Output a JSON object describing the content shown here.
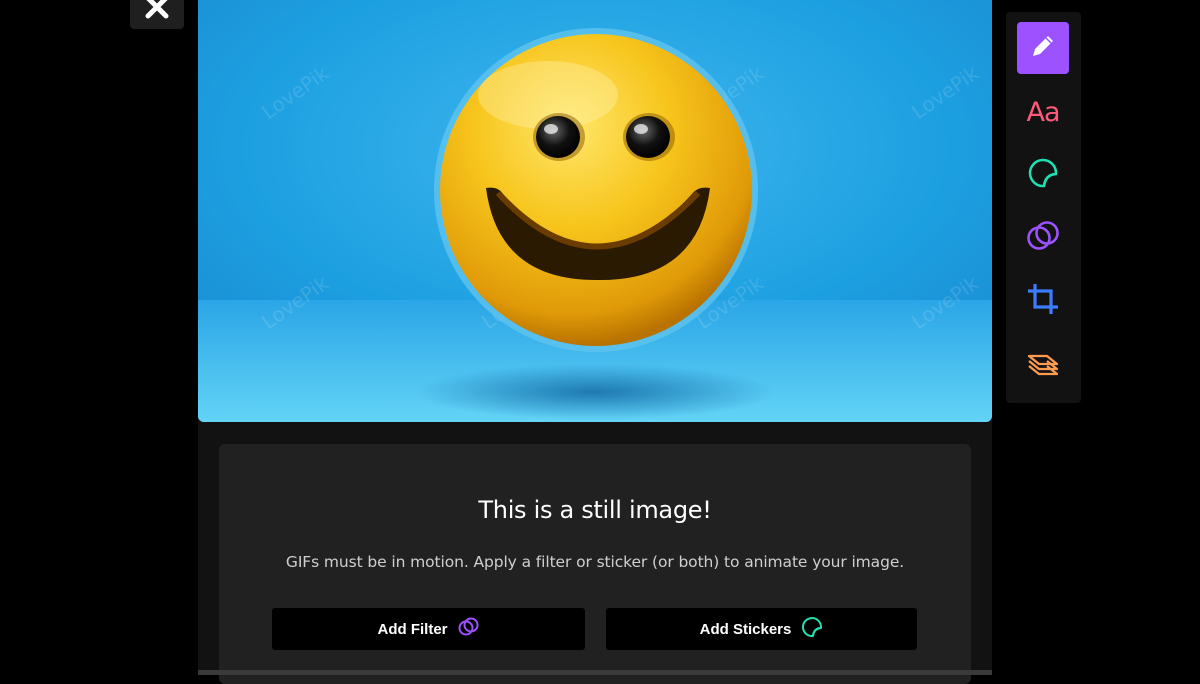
{
  "close": {
    "icon": "close-icon"
  },
  "preview": {
    "watermark": "LovePik",
    "colors": {
      "sky": "#23a7e8",
      "face": "#f2c31b"
    }
  },
  "info": {
    "title": "This is a still image!",
    "subtitle": "GIFs must be in motion. Apply a filter or sticker (or both) to animate your image."
  },
  "buttons": {
    "add_filter": {
      "label": "Add Filter",
      "icon": "filter-icon"
    },
    "add_stickers": {
      "label": "Add Stickers",
      "icon": "sticker-icon"
    }
  },
  "toolbar": {
    "items": [
      {
        "name": "draw",
        "icon": "pencil-icon",
        "active": true
      },
      {
        "name": "text",
        "label": "Aa",
        "icon": "text-icon",
        "color": "#ff5a7a"
      },
      {
        "name": "stickers",
        "icon": "sticker-icon",
        "color": "#1fe0b3"
      },
      {
        "name": "filters",
        "icon": "filter-icon",
        "color": "#9c52ff"
      },
      {
        "name": "crop",
        "icon": "crop-icon",
        "color": "#3d7cff"
      },
      {
        "name": "layers",
        "icon": "layers-icon",
        "color": "#ff9c4f"
      }
    ],
    "active_color": "#9c52ff"
  }
}
